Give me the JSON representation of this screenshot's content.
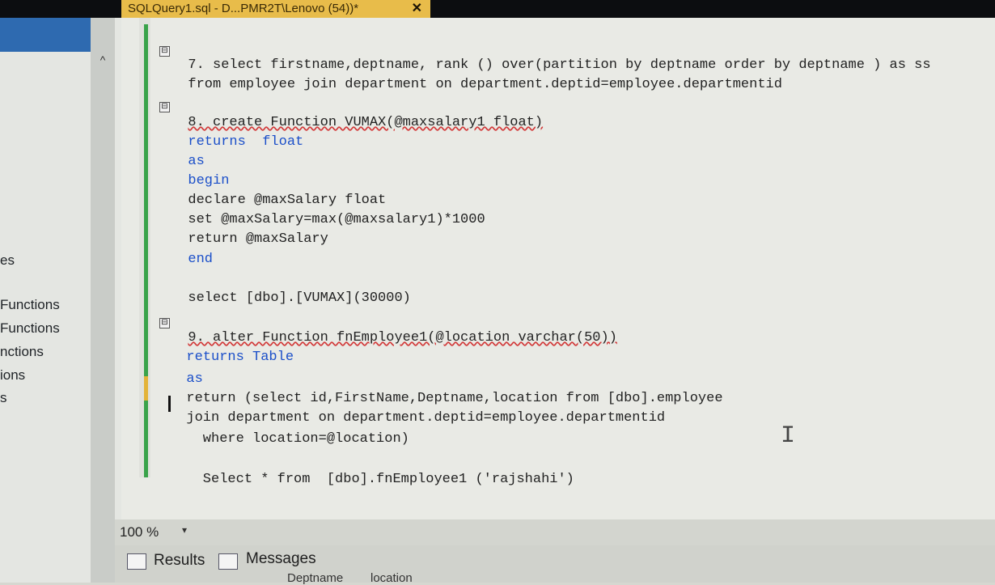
{
  "window": {
    "tab_title": "SQLQuery1.sql - D...PMR2T\\Lenovo (54))*",
    "close_glyph": "✕"
  },
  "explorer": {
    "scroll_up_glyph": "^",
    "items": [
      "es",
      "Functions",
      "Functions",
      "nctions",
      "ions",
      "s"
    ]
  },
  "editor": {
    "zoom": "100 %",
    "outline_toggle": "⊟",
    "caret_glyph": "I"
  },
  "code": {
    "l1": "7. select firstname,deptname, rank () over(partition by deptname order by deptname ) as ss",
    "l2": "from employee join department on department.deptid=employee.departmentid",
    "l3": "8. create Function VUMAX(@maxsalary1 float)",
    "l4": "returns  float",
    "l5": "as",
    "l6": "begin",
    "l7": "declare @maxSalary float",
    "l8": "set @maxSalary=max(@maxsalary1)*1000",
    "l9": "return @maxSalary",
    "l10": "end",
    "l11": "select [dbo].[VUMAX](30000)",
    "l12": "9. alter Function fnEmployee1(@location varchar(50))",
    "l13": "returns Table",
    "l14": "as",
    "l15": "return (select id,FirstName,Deptname,location from [dbo].employee",
    "l16": "join department on department.deptid=employee.departmentid",
    "l17": "  where location=@location)",
    "l18": "  Select * from  [dbo].fnEmployee1 ('rajshahi')"
  },
  "results_panel": {
    "tabs": [
      {
        "label": "Results"
      },
      {
        "label": "Messages"
      }
    ],
    "columns": [
      "Deptname",
      "location"
    ]
  },
  "colors": {
    "keyword": "#1b4fc9",
    "function": "#c25b9a",
    "string": "#b03a3a",
    "tab_active": "#e8bc4a"
  }
}
